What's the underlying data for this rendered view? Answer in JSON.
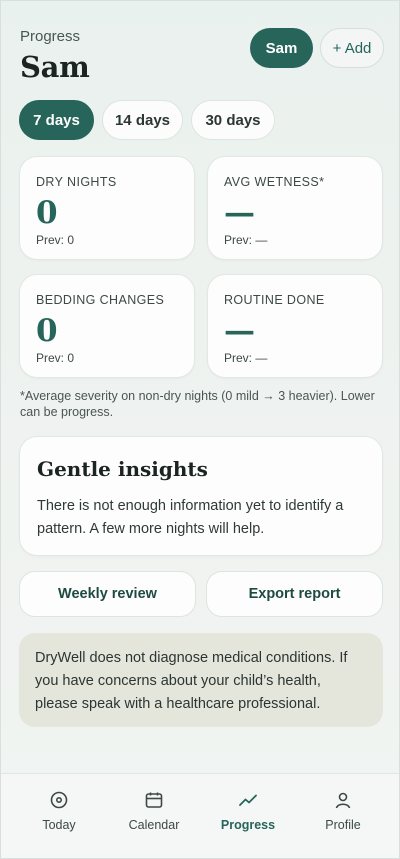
{
  "header": {
    "kicker": "Progress",
    "title": "Sam",
    "child_button": "Sam",
    "add_button": "+ Add"
  },
  "ranges": [
    {
      "label": "7 days",
      "active": true
    },
    {
      "label": "14 days",
      "active": false
    },
    {
      "label": "30 days",
      "active": false
    }
  ],
  "stats": [
    {
      "label": "DRY NIGHTS",
      "value": "0",
      "prev": "Prev: 0"
    },
    {
      "label": "AVG WETNESS*",
      "value": "—",
      "prev": "Prev: —"
    },
    {
      "label": "BEDDING CHANGES",
      "value": "0",
      "prev": "Prev: 0"
    },
    {
      "label": "ROUTINE DONE",
      "value": "—",
      "prev": "Prev: —"
    }
  ],
  "footnote": "*Average severity on non-dry nights (0 mild → 3 heavier). Lower can be progress.",
  "insights": {
    "title": "Gentle insights",
    "body": "There is not enough information yet to identify a pattern. A few more nights will help."
  },
  "actions": {
    "weekly_review": "Weekly review",
    "export_report": "Export report"
  },
  "disclaimer": "DryWell does not diagnose medical conditions. If you have concerns about your child’s health, please speak with a healthcare professional.",
  "tabs": [
    {
      "label": "Today",
      "icon": "today-icon",
      "active": false
    },
    {
      "label": "Calendar",
      "icon": "calendar-icon",
      "active": false
    },
    {
      "label": "Progress",
      "icon": "progress-icon",
      "active": true
    },
    {
      "label": "Profile",
      "icon": "profile-icon",
      "active": false
    }
  ],
  "colors": {
    "accent": "#27655a",
    "disclaimer_bg": "#e4e6dc"
  }
}
